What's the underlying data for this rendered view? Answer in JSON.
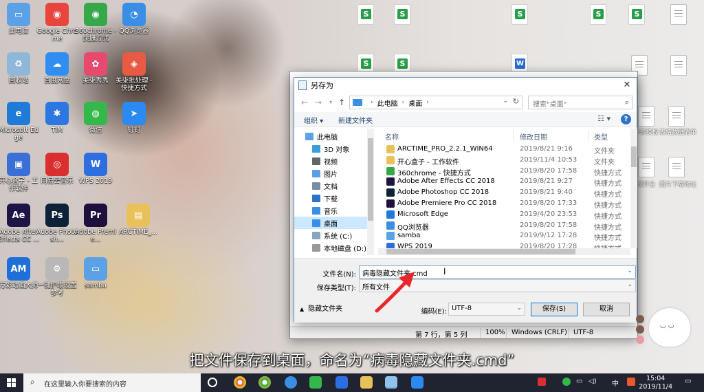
{
  "desktop": {
    "icons": [
      {
        "label": "此电脑",
        "color": "#5aa1e8",
        "glyph": "▭"
      },
      {
        "label": "Google Chrome",
        "color": "#e8453c",
        "glyph": "◉"
      },
      {
        "label": "360chrome - 快捷方式",
        "color": "#36a84a",
        "glyph": "◉"
      },
      {
        "label": "QQ浏览器",
        "color": "#3a8ee6",
        "glyph": "◔"
      },
      {
        "label": "回收站",
        "color": "#8fb8d8",
        "glyph": "♻"
      },
      {
        "label": "百度网盘",
        "color": "#2f8ef0",
        "glyph": "☁"
      },
      {
        "label": "美柒秀秀",
        "color": "#e84a6f",
        "glyph": "✿"
      },
      {
        "label": "美柒批处理 - 快捷方式",
        "color": "#e85a44",
        "glyph": "◈"
      },
      {
        "label": "Microsoft Edge",
        "color": "#1f7ad8",
        "glyph": "e"
      },
      {
        "label": "TIM",
        "color": "#2d78e0",
        "glyph": "✱"
      },
      {
        "label": "微信",
        "color": "#35b84a",
        "glyph": "◍"
      },
      {
        "label": "钉钉",
        "color": "#2a8af0",
        "glyph": "➤"
      },
      {
        "label": "开心盒子 - 工作软件",
        "color": "#3b6fd8",
        "glyph": "▣"
      },
      {
        "label": "网易云音乐",
        "color": "#d9302f",
        "glyph": "◎"
      },
      {
        "label": "WPS 2019",
        "color": "#2d6fe0",
        "glyph": "W"
      },
      {
        "label": "Adobe After Effects CC ...",
        "color": "#1d1546",
        "glyph": "Ae"
      },
      {
        "label": "Adobe Photosh...",
        "color": "#0d2138",
        "glyph": "Ps"
      },
      {
        "label": "Adobe Premie...",
        "color": "#1e0f3c",
        "glyph": "Pr"
      },
      {
        "label": "ARCTIME_...",
        "color": "#e8c15a",
        "glyph": "▤"
      },
      {
        "label": "万彩动画大师",
        "color": "#1f6fd8",
        "glyph": "AM"
      },
      {
        "label": "一键护眼设置参考",
        "color": "#b8b8b8",
        "glyph": "⚙"
      },
      {
        "label": "samba",
        "color": "#5aa1e8",
        "glyph": "▭"
      }
    ],
    "right_labels": [
      "工作表模板",
      "表格数据清单",
      "体现开会",
      "图片下载地址",
      "销售统计",
      "个人统计表"
    ]
  },
  "notepad": {
    "status_position": "第 7 行，第 5 列",
    "status_zoom": "100%",
    "status_eol": "Windows (CRLF)",
    "status_encoding": "UTF-8"
  },
  "dialog": {
    "title": "另存为",
    "close_glyph": "✕",
    "address": {
      "root": "此电脑",
      "current": "桌面"
    },
    "search_placeholder": "搜索\"桌面\"",
    "toolbar": {
      "organize": "组织 ▾",
      "new_folder": "新建文件夹"
    },
    "tree": [
      {
        "label": "此电脑",
        "color": "#5aa1e8"
      },
      {
        "label": "3D 对象",
        "color": "#3aa0d8"
      },
      {
        "label": "视频",
        "color": "#666"
      },
      {
        "label": "图片",
        "color": "#5aa1e8"
      },
      {
        "label": "文档",
        "color": "#7a8da6"
      },
      {
        "label": "下载",
        "color": "#2f72c8"
      },
      {
        "label": "音乐",
        "color": "#3a8ee6"
      },
      {
        "label": "桌面",
        "color": "#3a8ee6"
      },
      {
        "label": "系统 (C:)",
        "color": "#8aa5c0"
      },
      {
        "label": "本地磁盘 (D:)",
        "color": "#9a9a9a"
      }
    ],
    "columns": {
      "name": "名称",
      "modified": "修改日期",
      "type": "类型"
    },
    "files": [
      {
        "name": "ARCTIME_PRO_2.2.1_WIN64",
        "date": "2019/8/21 9:16",
        "type": "文件夹",
        "color": "#e8c15a"
      },
      {
        "name": "开心盒子 - 工作软件",
        "date": "2019/11/4 10:53",
        "type": "文件夹",
        "color": "#e8c15a"
      },
      {
        "name": "360chrome - 快捷方式",
        "date": "2019/8/20 17:58",
        "type": "快捷方式",
        "color": "#36a84a"
      },
      {
        "name": "Adobe After Effects CC 2018",
        "date": "2019/8/21 9:27",
        "type": "快捷方式",
        "color": "#1d1546"
      },
      {
        "name": "Adobe Photoshop CC 2018",
        "date": "2019/8/21 9:40",
        "type": "快捷方式",
        "color": "#0d2138"
      },
      {
        "name": "Adobe Premiere Pro CC 2018",
        "date": "2019/8/20 17:33",
        "type": "快捷方式",
        "color": "#1e0f3c"
      },
      {
        "name": "Microsoft Edge",
        "date": "2019/4/20 23:53",
        "type": "快捷方式",
        "color": "#1f7ad8"
      },
      {
        "name": "QQ浏览器",
        "date": "2019/8/20 17:58",
        "type": "快捷方式",
        "color": "#3a8ee6"
      },
      {
        "name": "samba",
        "date": "2019/9/12 17:28",
        "type": "快捷方式",
        "color": "#5aa1e8"
      },
      {
        "name": "WPS 2019",
        "date": "2019/8/20 17:28",
        "type": "快捷方式",
        "color": "#2d6fe0"
      }
    ],
    "filename_label": "文件名(N):",
    "filename_value": "病毒隐藏文件夹.cmd",
    "filetype_label": "保存类型(T):",
    "filetype_value": "所有文件",
    "hide_folders": "隐藏文件夹",
    "encoding_label": "编码(E):",
    "encoding_value": "UTF-8",
    "save_button": "保存(S)",
    "cancel_button": "取消"
  },
  "caption": "把文件保存到桌面，命名为“病毒隐藏文件夹.cmd”",
  "taskbar": {
    "search_placeholder": "在这里输入你要搜索的内容",
    "ime": "中",
    "clock_time": "15:04",
    "clock_date": "2019/11/4"
  },
  "colors": {
    "accent": "#0078d7",
    "selection": "#cce8ff",
    "arrow": "#e8262b"
  }
}
